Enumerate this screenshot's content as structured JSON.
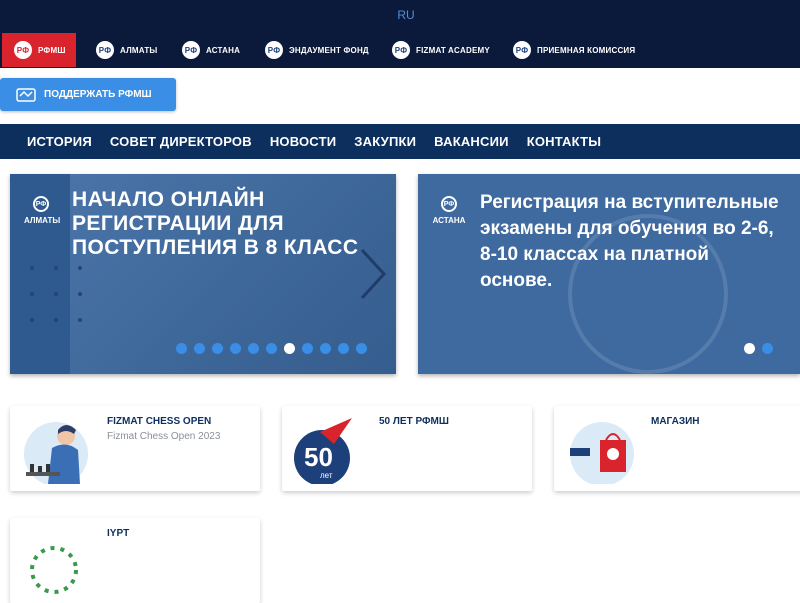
{
  "topbar": {
    "lang": "RU",
    "sites": [
      {
        "label": "РФМШ",
        "active": true
      },
      {
        "label": "АЛМАТЫ"
      },
      {
        "label": "АСТАНА"
      },
      {
        "label": "ЭНДАУМЕНТ ФОНД"
      },
      {
        "label": "FIZMAT ACADEMY"
      },
      {
        "label": "ПРИЕМНАЯ КОМИССИЯ"
      }
    ],
    "logo_text": "РФ"
  },
  "support": {
    "label": "ПОДДЕРЖАТЬ РФМШ",
    "icon": "handshake-icon"
  },
  "nav": {
    "items": [
      "ИСТОРИЯ",
      "СОВЕТ ДИРЕКТОРОВ",
      "НОВОСТИ",
      "ЗАКУПКИ",
      "ВАКАНСИИ",
      "КОНТАКТЫ"
    ]
  },
  "slider_left": {
    "badge": "АЛМАТЫ",
    "title": "НАЧАЛО ОНЛАЙН РЕГИСТРАЦИИ ДЛЯ ПОСТУПЛЕНИЯ В 8 КЛАСС",
    "dot_count": 11,
    "active_dot": 7
  },
  "slider_right": {
    "badge": "АСТАНА",
    "title": "Регистрация на вступительные экзамены для обучения во 2-6, 8-10 классах на платной основе.",
    "dot_count": 2,
    "active_dot": 1
  },
  "cards": [
    {
      "title": "FIZMAT CHESS OPEN",
      "subtitle": "Fizmat Chess Open 2023"
    },
    {
      "title": "50 ЛЕТ РФМШ",
      "subtitle": "",
      "badge_number": "50",
      "badge_word": "лет"
    },
    {
      "title": "МАГАЗИН",
      "subtitle": ""
    },
    {
      "title": "IYPT",
      "subtitle": ""
    }
  ],
  "colors": {
    "topbar": "#0b1a3a",
    "active_tab": "#d9232d",
    "accent": "#3a8ee6",
    "nav": "#0d2f5e",
    "slide": "#3e6aa0"
  }
}
